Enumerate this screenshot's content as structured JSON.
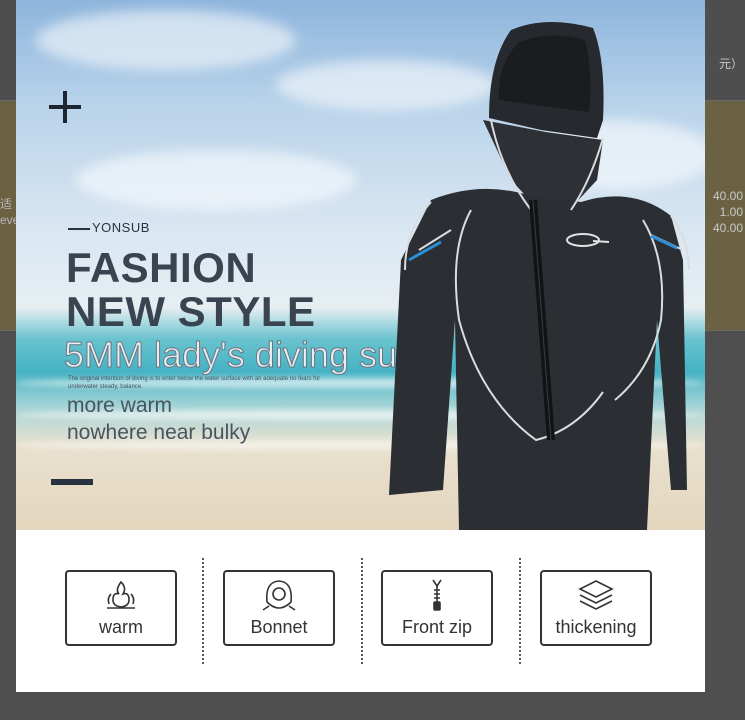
{
  "background": {
    "right_top_text": "元）",
    "left_text": [
      "适",
      "eve"
    ],
    "right_prices": [
      "40.00",
      "1.00",
      "40.00"
    ]
  },
  "banner": {
    "brand": "YONSUB",
    "headline_line1": "FASHION",
    "headline_line2": "NEW STYLE",
    "subhead": "5MM lady's diving suit",
    "fine_print": "The original intention of diving is to enter below the water surface with an adequate no fears for underwater steady, balance.",
    "tagline_line1": "more warm",
    "tagline_line2": "nowhere near bulky"
  },
  "features": [
    {
      "label": "warm",
      "icon": "flame-icon"
    },
    {
      "label": "Bonnet",
      "icon": "hood-icon"
    },
    {
      "label": "Front zip",
      "icon": "zipper-icon"
    },
    {
      "label": "thickening",
      "icon": "layers-icon"
    }
  ],
  "colors": {
    "headline": "#3a4350",
    "suit": "#2b2e33",
    "stitching": "#d9dde0",
    "accent": "#2c8fd6"
  }
}
